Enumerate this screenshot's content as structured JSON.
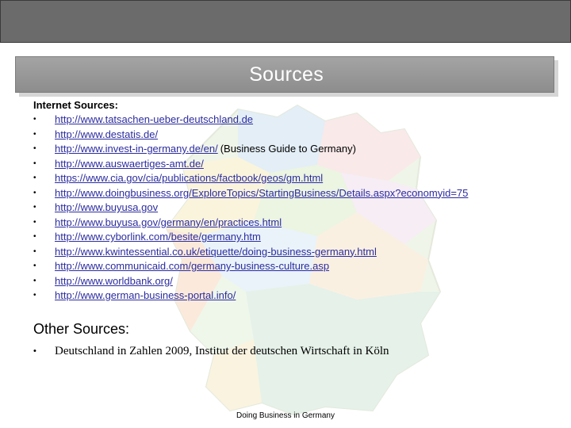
{
  "title": "Sources",
  "internet_sources": {
    "heading": "Internet Sources:",
    "bullet": "•",
    "links": [
      {
        "url": "http://www.tatsachen-ueber-deutschland.de",
        "note": ""
      },
      {
        "url": "http://www.destatis.de/",
        "note": ""
      },
      {
        "url": "http://www.invest-in-germany.de/en/",
        "note": "(Business Guide to Germany)"
      },
      {
        "url": "http://www.auswaertiges-amt.de/",
        "note": ""
      },
      {
        "url": "https://www.cia.gov/cia/publications/factbook/geos/gm.html",
        "note": ""
      },
      {
        "url": "http://www.doingbusiness.org/ExploreTopics/StartingBusiness/Details.aspx?economyid=75",
        "note": ""
      },
      {
        "url": "http://www.buyusa.gov",
        "note": ""
      },
      {
        "url": "http://www.buyusa.gov/germany/en/practices.html",
        "note": ""
      },
      {
        "url": "http://www.cyborlink.com/besite/germany.htm",
        "note": ""
      },
      {
        "url": "http://www.kwintessential.co.uk/etiquette/doing-business-germany.html",
        "note": ""
      },
      {
        "url": "http://www.communicaid.com/germany-business-culture.asp",
        "note": ""
      },
      {
        "url": "http://www.worldbank.org/",
        "note": ""
      },
      {
        "url": "http://www.german-business-portal.info/",
        "note": ""
      }
    ]
  },
  "other_sources": {
    "heading": "Other Sources:",
    "bullet": "•",
    "items": [
      "Deutschland in Zahlen 2009, Institut der deutschen Wirtschaft in Köln"
    ]
  },
  "footer": "Doing Business in Germany",
  "colors": {
    "link": "#2c2ca0",
    "title_bar": "#999999",
    "top_bar": "#6b6b6b"
  }
}
